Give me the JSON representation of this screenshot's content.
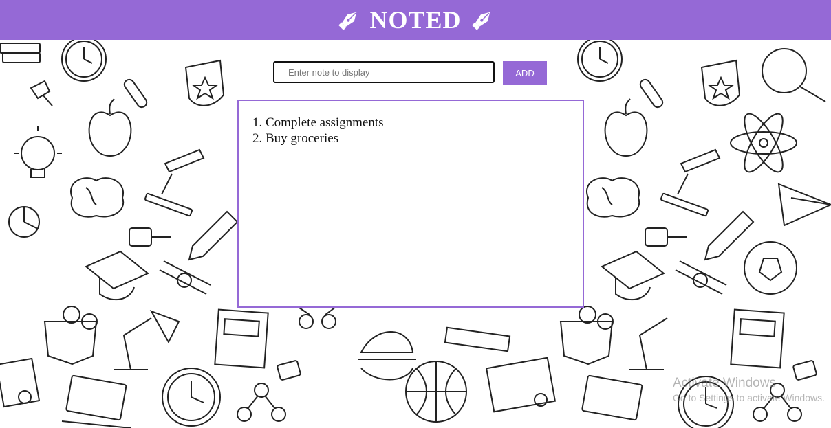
{
  "app": {
    "title": "NOTED"
  },
  "header": {
    "left_icon": "fountain-pen-icon",
    "right_icon": "fountain-pen-icon",
    "background_color": "#9569d6"
  },
  "note_input": {
    "value": "",
    "placeholder": "Enter note to display"
  },
  "add_button": {
    "label": "ADD"
  },
  "notes": [
    "1. Complete assignments",
    "2. Buy groceries"
  ],
  "background": {
    "pattern": "school-doodles"
  },
  "os_watermark": {
    "title": "Activate Windows",
    "subtitle": "Go to Settings to activate Windows."
  }
}
